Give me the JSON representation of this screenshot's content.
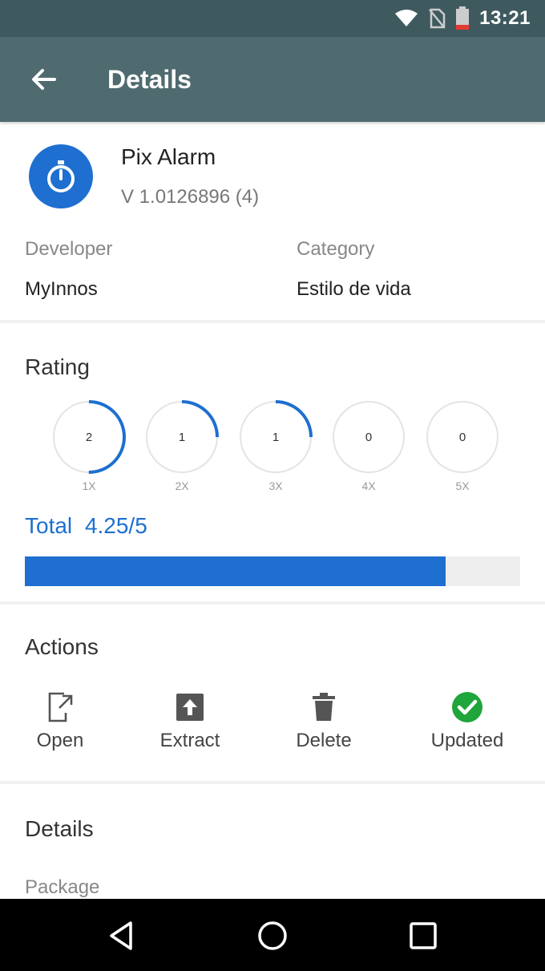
{
  "status_bar": {
    "time": "13:21"
  },
  "app_bar": {
    "title": "Details"
  },
  "app": {
    "name": "Pix Alarm",
    "version": "V 1.0126896 (4)",
    "developer_label": "Developer",
    "developer": "MyInnos",
    "category_label": "Category",
    "category": "Estilo de vida"
  },
  "rating": {
    "title": "Rating",
    "items": [
      {
        "count": "2",
        "label": "1X",
        "fraction": 0.5
      },
      {
        "count": "1",
        "label": "2X",
        "fraction": 0.25
      },
      {
        "count": "1",
        "label": "3X",
        "fraction": 0.25
      },
      {
        "count": "0",
        "label": "4X",
        "fraction": 0
      },
      {
        "count": "0",
        "label": "5X",
        "fraction": 0
      }
    ],
    "total_label": "Total",
    "total_value": "4.25/5",
    "progress_fraction": 0.85
  },
  "actions": {
    "title": "Actions",
    "open": "Open",
    "extract": "Extract",
    "delete": "Delete",
    "updated": "Updated"
  },
  "details": {
    "title": "Details",
    "package_label": "Package"
  },
  "colors": {
    "accent": "#1e6fd0",
    "app_bar": "#4f6b6f",
    "status_bar": "#3f5a5f",
    "updated_green": "#1fa53a"
  }
}
